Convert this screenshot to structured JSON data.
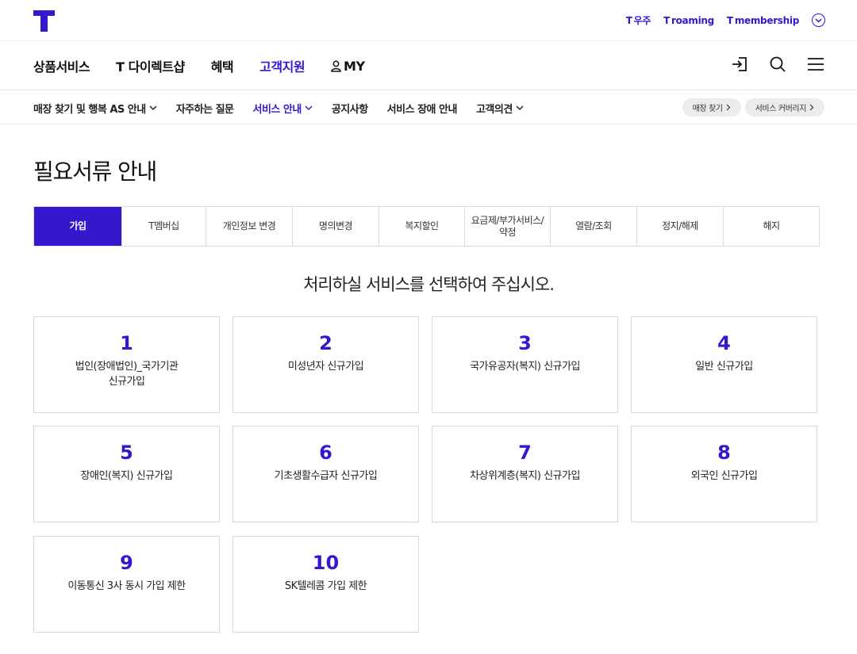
{
  "top": {
    "links": [
      {
        "mark": "T",
        "label": "우주"
      },
      {
        "mark": "T",
        "label": "roaming"
      },
      {
        "mark": "T",
        "label": "membership"
      }
    ]
  },
  "gnb": {
    "items": [
      "상품서비스",
      "T 다이렉트샵",
      "혜택",
      "고객지원",
      "MY"
    ],
    "active_index": 3
  },
  "lnb": {
    "items": [
      "매장 찾기 및 행복 AS 안내",
      "자주하는 질문",
      "서비스 안내",
      "공지사항",
      "서비스 장애 안내",
      "고객의견"
    ],
    "active_index": 2,
    "pills": [
      "매장 찾기",
      "서비스 커버리지"
    ]
  },
  "page": {
    "title": "필요서류 안내",
    "prompt": "처리하실 서비스를 선택하여 주십시오."
  },
  "tabs": [
    "가입",
    "T멤버십",
    "개인정보 변경",
    "명의변경",
    "복지할인",
    "요금제/부가서비스/약정",
    "열람/조회",
    "정지/해제",
    "해지"
  ],
  "tab_lines": {
    "t5a": "요금제/부가서비스/",
    "t5b": "약정"
  },
  "cards": [
    {
      "num": "1",
      "line1": "법인(장애법인)_국가기관",
      "line2": "신규가입"
    },
    {
      "num": "2",
      "line1": "미성년자 신규가입"
    },
    {
      "num": "3",
      "line1": "국가유공자(복지) 신규가입"
    },
    {
      "num": "4",
      "line1": "일반 신규가입"
    },
    {
      "num": "5",
      "line1": "장애인(복지) 신규가입"
    },
    {
      "num": "6",
      "line1": "기초생활수급자 신규가입"
    },
    {
      "num": "7",
      "line1": "차상위계층(복지) 신규가입"
    },
    {
      "num": "8",
      "line1": "외국인 신규가입"
    },
    {
      "num": "9",
      "line1": "이동통신 3사 동시 가입 제한"
    },
    {
      "num": "10",
      "line1": "SK텔레콤 가입 제한"
    }
  ],
  "colors": {
    "brand": "#3617ce"
  }
}
